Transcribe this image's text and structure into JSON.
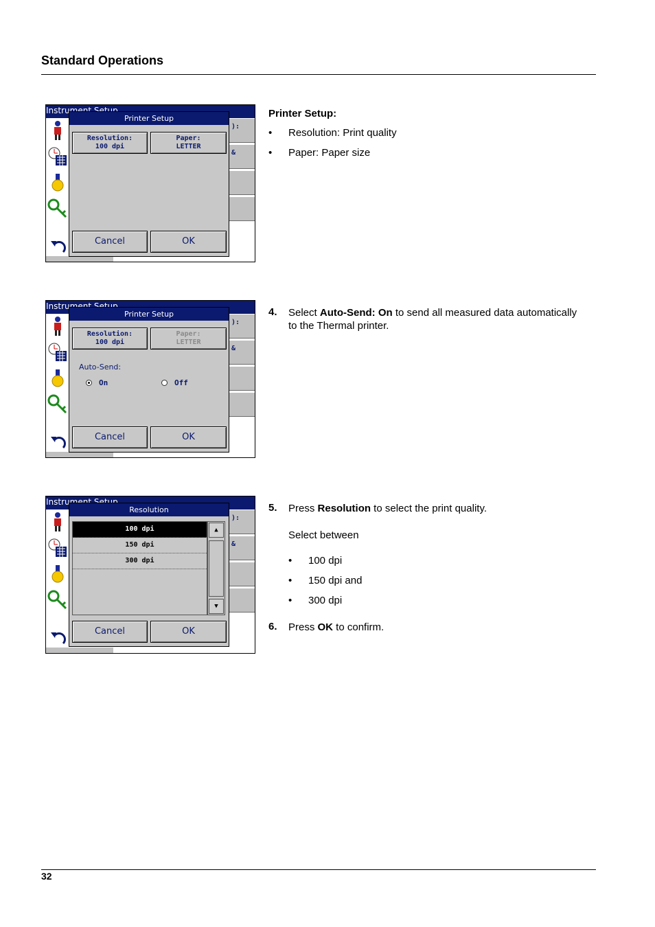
{
  "header": {
    "title": "Standard Operations"
  },
  "footer": {
    "page_number": "32"
  },
  "screen_common": {
    "window_title": "Instrument Setup",
    "row_fragments": [
      "):",
      "&"
    ]
  },
  "screens": [
    {
      "dialog_title": "Printer Setup",
      "resolution_btn": {
        "line1": "Resolution:",
        "line2": "100 dpi"
      },
      "paper_btn": {
        "line1": "Paper:",
        "line2": "LETTER"
      },
      "cancel": "Cancel",
      "ok": "OK"
    },
    {
      "dialog_title": "Printer Setup",
      "resolution_btn": {
        "line1": "Resolution:",
        "line2": "100 dpi"
      },
      "paper_btn": {
        "line1": "Paper:",
        "line2": "LETTER"
      },
      "autosend_label": "Auto-Send:",
      "radio_on": "On",
      "radio_off": "Off",
      "cancel": "Cancel",
      "ok": "OK"
    },
    {
      "dialog_title": "Resolution",
      "options": [
        "100 dpi",
        "150 dpi",
        "300 dpi"
      ],
      "selected_option": "100 dpi",
      "cancel": "Cancel",
      "ok": "OK"
    }
  ],
  "text": {
    "printer_setup_heading": "Printer Setup:",
    "bullets1": [
      "Resolution: Print quality",
      "Paper: Paper size"
    ],
    "step4_num": "4.",
    "step4_pre": "Select ",
    "step4_bold": "Auto-Send: On",
    "step4_post": " to send all measured data automatically",
    "step4_line2": "to the Thermal printer.",
    "step5_num": "5.",
    "step5_pre": "Press ",
    "step5_bold": "Resolution",
    "step5_post": " to select the print quality.",
    "select_between": "Select between",
    "bullets2": [
      "100 dpi",
      "150 dpi and",
      "300 dpi"
    ],
    "step6_num": "6.",
    "step6_pre": "Press ",
    "step6_bold": "OK",
    "step6_post": " to confirm."
  }
}
